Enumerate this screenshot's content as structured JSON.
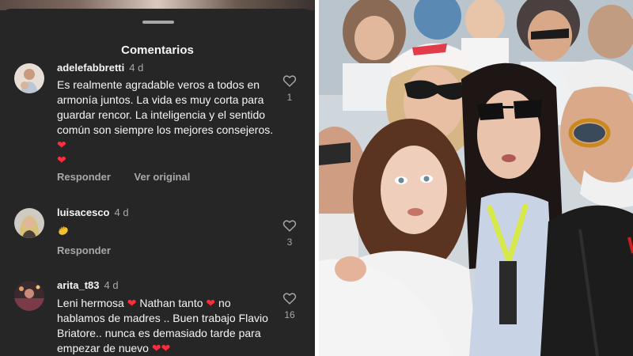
{
  "sheet": {
    "title": "Comentarios",
    "colors": {
      "background": "#262626",
      "text": "#f5f5f5",
      "muted": "#a8a8a8",
      "heart": "#ff2d3b"
    }
  },
  "comments": [
    {
      "username": "adelefabbretti",
      "age": "4 d",
      "text": "Es realmente agradable veros a todos en armonía juntos. La vida es muy corta para guardar rencor. La inteligencia y el sentido común son siempre los mejores consejeros.",
      "reply_label": "Responder",
      "translate_label": "Ver original",
      "likes": "1"
    },
    {
      "username": "luisacesco",
      "age": "4 d",
      "reply_label": "Responder",
      "likes": "3"
    },
    {
      "username": "arita_t83",
      "age": "4 d",
      "text_parts": [
        "Leni hermosa",
        "Nathan tanto",
        "no hablamos de madres .. Buen trabajo Flavio Briatore.. nunca es demasiado tarde para empezar de nuevo"
      ],
      "likes": "16"
    }
  ],
  "icons": {
    "drag": "drag-handle",
    "like": "heart-outline-icon",
    "emoji_heart": "red-heart-emoji",
    "emoji_clap": "clap-emoji"
  },
  "photo": {
    "description_icon": "selfie-photo"
  }
}
